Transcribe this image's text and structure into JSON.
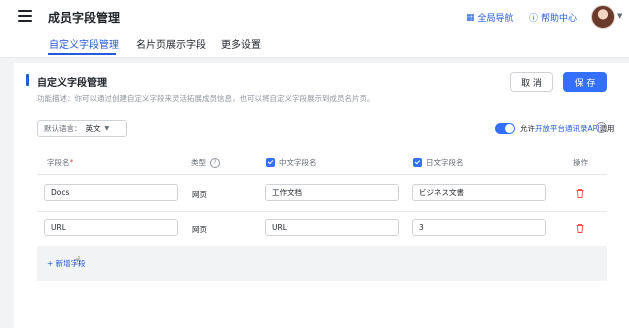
{
  "header": {
    "title": "成员字段管理",
    "global_nav_label": "全局导航",
    "help_center_label": "帮助中心",
    "tabs": [
      {
        "label": "自定义字段管理",
        "active": true
      },
      {
        "label": "名片页展示字段",
        "active": false
      },
      {
        "label": "更多设置",
        "active": false
      }
    ]
  },
  "section": {
    "title": "自定义字段管理",
    "description": "功能描述：你可以通过创建自定义字段来灵活拓展成员信息，也可以将自定义字段展示到成员名片页。",
    "cancel_label": "取 消",
    "save_label": "保 存"
  },
  "language": {
    "label": "默认语言：",
    "value": "英文"
  },
  "api_toggle": {
    "enabled": true,
    "text_before": "允许",
    "text_highlight": "开放平台通讯录API",
    "text_after": "调用"
  },
  "table": {
    "headers": {
      "name": "字段名",
      "required_mark": "*",
      "type": "类型",
      "zh": "中文字段名",
      "ja": "日文字段名",
      "action": "操作"
    },
    "rows": [
      {
        "name": "Docs",
        "type": "网页",
        "zh": "工作文档",
        "ja": "ビジネス文書"
      },
      {
        "name": "URL",
        "type": "网页",
        "zh": "URL",
        "ja": "3"
      }
    ],
    "add_label": "+ 新增字段"
  },
  "colors": {
    "accent": "#3370ff",
    "link": "#245bdb",
    "danger": "#f54a45"
  }
}
